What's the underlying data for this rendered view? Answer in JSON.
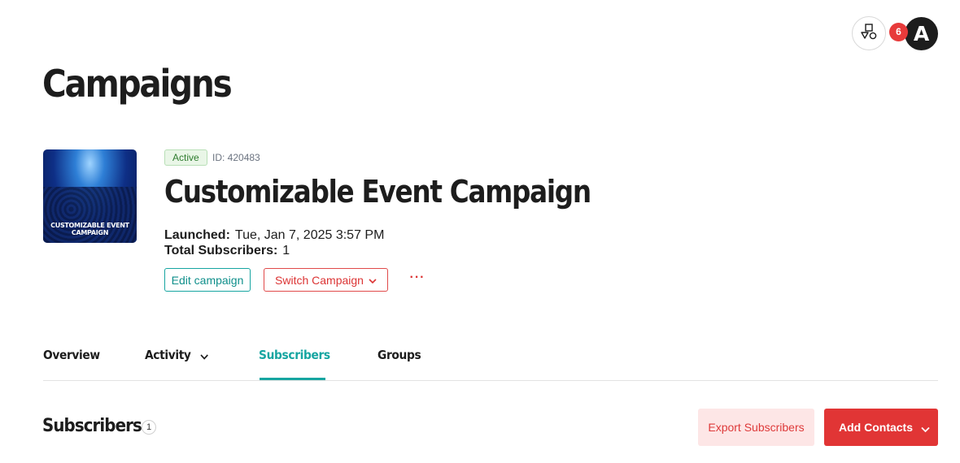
{
  "header": {
    "notification_count": "6",
    "avatar_initial": "A",
    "shapes_icon": "shapes-icon"
  },
  "page_title": "Campaigns",
  "campaign": {
    "thumbnail_caption": "CUSTOMIZABLE EVENT CAMPAIGN",
    "status": "Active",
    "id_label": "ID: 420483",
    "name": "Customizable Event Campaign",
    "launched_label": "Launched:",
    "launched_value": "Tue, Jan 7, 2025 3:57 PM",
    "subscribers_label": "Total Subscribers:",
    "subscribers_value": "1",
    "edit_label": "Edit campaign",
    "switch_label": "Switch Campaign",
    "more_label": "···"
  },
  "tabs": [
    {
      "label": "Overview"
    },
    {
      "label": "Activity"
    },
    {
      "label": "Subscribers",
      "active": true
    },
    {
      "label": "Groups"
    }
  ],
  "section": {
    "title": "Subscribers",
    "count": "1",
    "export_label": "Export Subscribers",
    "add_label": "Add Contacts"
  },
  "colors": {
    "teal": "#16a5a1",
    "red": "#e13535",
    "active_green": "#2f7c2f"
  }
}
